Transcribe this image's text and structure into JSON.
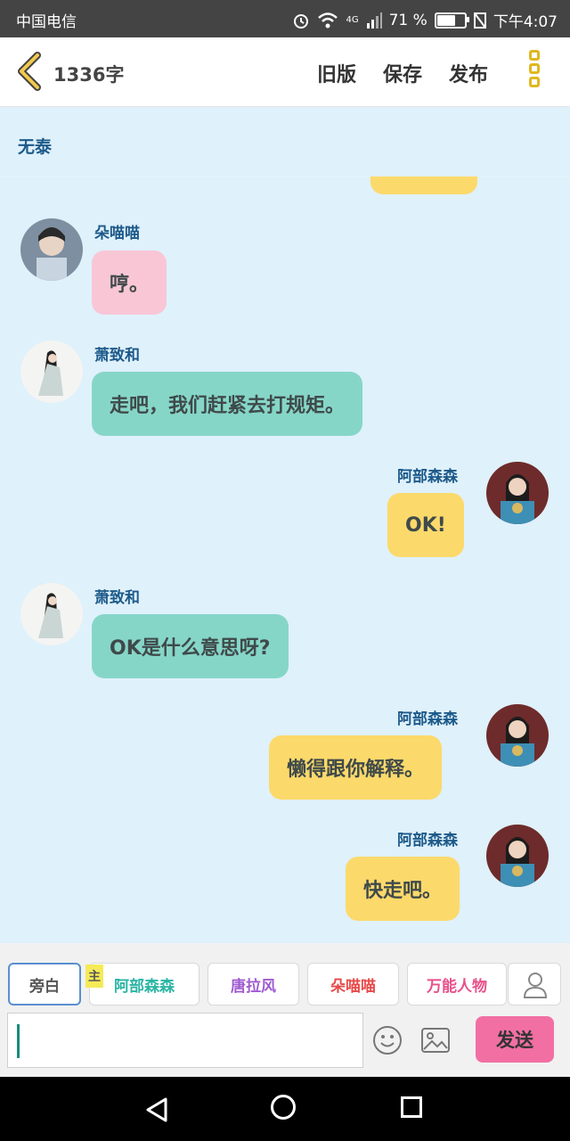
{
  "status": {
    "carrier": "中国电信",
    "network": "4G",
    "battery": "71 %",
    "battery_level": 0.71,
    "time": "下午4:07"
  },
  "header": {
    "word_count": "1336字",
    "old_version": "旧版",
    "save": "保存",
    "publish": "发布"
  },
  "chat": {
    "scene_label": "无泰",
    "messages": [
      {
        "name": "朵喵喵",
        "text": "哼。",
        "side": "left",
        "color": "#f9c6d6"
      },
      {
        "name": "萧致和",
        "text": "走吧，我们赶紧去打规矩。",
        "side": "left",
        "color": "#86d6c8"
      },
      {
        "name": "阿部森森",
        "text": "OK!",
        "side": "right",
        "color": "#fcd96b"
      },
      {
        "name": "萧致和",
        "text": "OK是什么意思呀?",
        "side": "left",
        "color": "#86d6c8"
      },
      {
        "name": "阿部森森",
        "text": "懒得跟你解释。",
        "side": "right",
        "color": "#fcd96b"
      },
      {
        "name": "阿部森森",
        "text": "快走吧。",
        "side": "right",
        "color": "#fcd96b"
      }
    ]
  },
  "bottom": {
    "characters": [
      {
        "label": "旁白",
        "color": "#555555",
        "selected": true
      },
      {
        "label": "阿部森森",
        "color": "#2bb5a5",
        "tag": "主"
      },
      {
        "label": "唐拉风",
        "color": "#a05bd0"
      },
      {
        "label": "朵喵喵",
        "color": "#e84a4a"
      },
      {
        "label": "万能人物",
        "color": "#e8508a"
      }
    ],
    "send_label": "发送"
  }
}
